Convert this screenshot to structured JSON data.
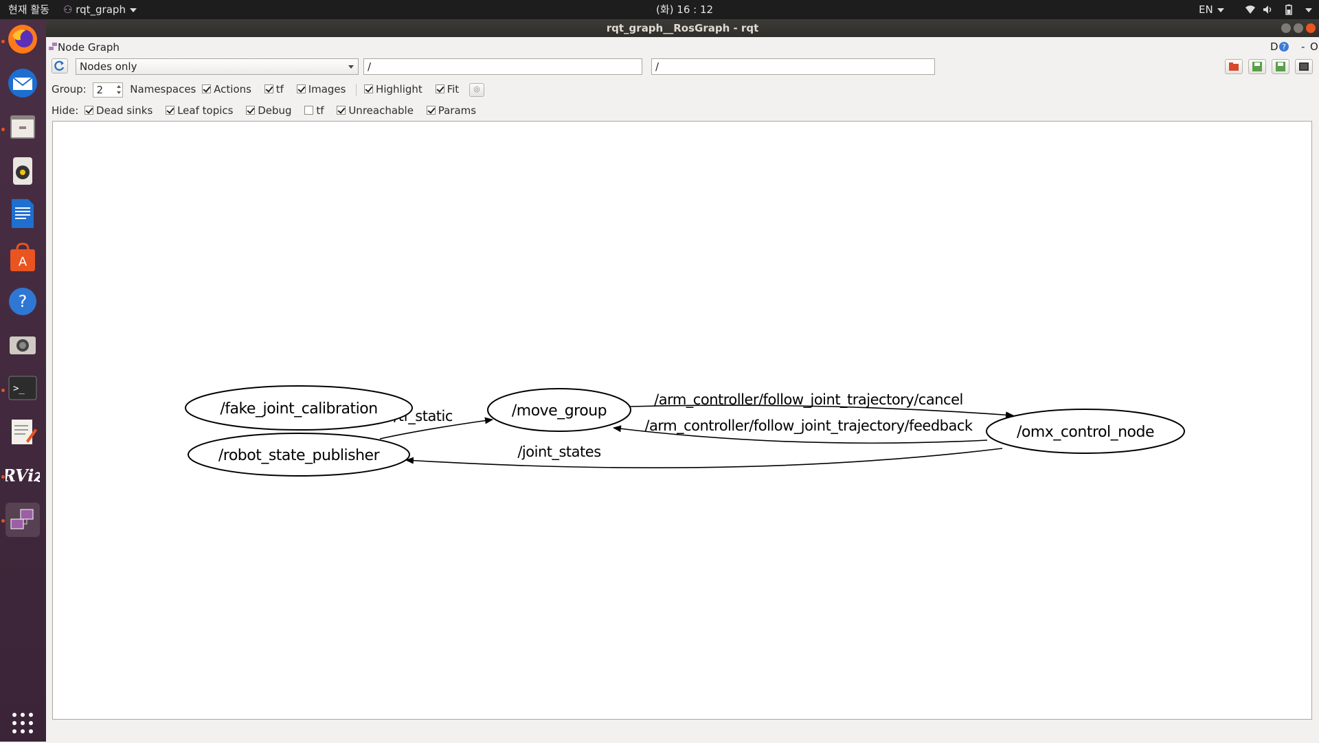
{
  "topbar": {
    "activities": "현재 활동",
    "app_menu": "rqt_graph",
    "clock": "(화) 16 : 12",
    "lang": "EN"
  },
  "dock": {
    "items": [
      "firefox-icon",
      "thunderbird-icon",
      "files-icon",
      "rhythmbox-icon",
      "writer-icon",
      "software-center-icon",
      "help-icon",
      "camera-icon",
      "terminal-icon",
      "text-editor-icon",
      "rviz-icon",
      "rqt-icon"
    ]
  },
  "window": {
    "title": "rqt_graph__RosGraph - rqt"
  },
  "plugin": {
    "title": "Node Graph",
    "corner_d": "D",
    "corner_minus": "-",
    "corner_o": "O"
  },
  "toolbar": {
    "mode": "Nodes only",
    "filter1": "/",
    "filter2": "/"
  },
  "options": {
    "group_label": "Group:",
    "group_value": "2",
    "namespaces": "Namespaces",
    "actions": "Actions",
    "tf": "tf",
    "images": "Images",
    "highlight": "Highlight",
    "fit": "Fit",
    "actions_checked": true,
    "tf_checked": true,
    "images_checked": true,
    "highlight_checked": true,
    "fit_checked": true
  },
  "hide": {
    "label": "Hide:",
    "dead_sinks": "Dead sinks",
    "leaf_topics": "Leaf topics",
    "debug": "Debug",
    "tf": "tf",
    "unreachable": "Unreachable",
    "params": "Params"
  },
  "graph": {
    "nodes": {
      "fake_joint_calibration": "/fake_joint_calibration",
      "robot_state_publisher": "/robot_state_publisher",
      "move_group": "/move_group",
      "omx_control_node": "/omx_control_node"
    },
    "edges": {
      "tf_static": "/tf_static",
      "cancel": "/arm_controller/follow_joint_trajectory/cancel",
      "feedback": "/arm_controller/follow_joint_trajectory/feedback",
      "joint_states": "/joint_states"
    }
  }
}
